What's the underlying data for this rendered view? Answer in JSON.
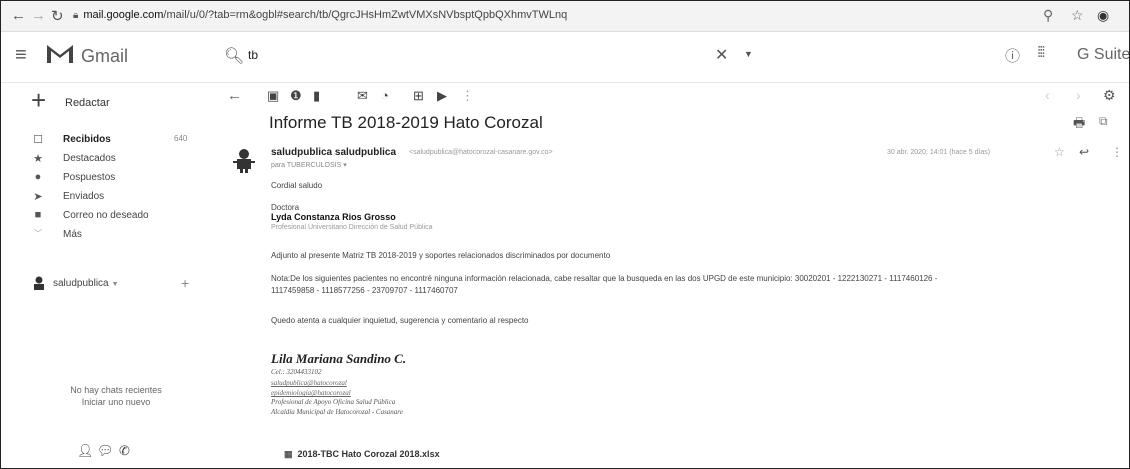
{
  "browser": {
    "back_icon": "arrow-left-icon",
    "forward_icon": "arrow-right-icon",
    "reload_icon": "reload-icon",
    "url_host": "mail.google.com",
    "url_path": "/mail/u/0/?tab=rm&ogbl#search/tb/QgrcJHsHmZwtVMXsNVbsptQpbQXhmvTWLnq"
  },
  "header": {
    "brand": "Gmail",
    "search_value": "tb",
    "apps_brand": "G Suite"
  },
  "sidebar": {
    "compose_label": "Redactar",
    "items": [
      {
        "label": "Recibidos",
        "count": "640",
        "icon": "inbox-icon"
      },
      {
        "label": "Destacados",
        "icon": "star-icon"
      },
      {
        "label": "Pospuestos",
        "icon": "clock-icon"
      },
      {
        "label": "Enviados",
        "icon": "send-icon"
      },
      {
        "label": "Correo no deseado",
        "icon": "label-icon"
      },
      {
        "label": "Más",
        "icon": "chevron-down-icon"
      }
    ],
    "hangouts_user": "saludpublica",
    "no_chats": "No hay chats recientes",
    "start_new": "Iniciar uno nuevo"
  },
  "message": {
    "subject": "Informe TB 2018-2019 Hato Corozal",
    "sender_name": "saludpublica saludpublica",
    "sender_email": "<saludpublica@hatocorozal-casanare.gov.co>",
    "to_line": "para TUBERCULOSIS ▾",
    "date": "30 abr. 2020, 14:01 (hace 5 días)",
    "greeting": "Cordial saludo",
    "doctor_title": "Doctora",
    "doctor_name": "Lyda Constanza Rios Grosso",
    "doctor_role": "Profesional Universitario Dirección de Salud Pública",
    "line_adjunto": "Adjunto al presente Matriz TB 2018-2019 y soportes relacionados discriminados por documento",
    "line_nota_1": "Nota:De los siguientes pacientes no encontré ninguna información relacionada, cabe resaltar que la busqueda en las dos UPGD de este municipio: 30020201 - 1222130271 - 1117460126 -",
    "line_nota_2": "1117459858 - 1118577256 - 23709707 - 1117460707",
    "line_quedo": "Quedo atenta a cualquier inquietud, sugerencia y comentario al respecto",
    "signature": {
      "name": "Lila Mariana Sandino C.",
      "cel": "Cel.: 3204433102",
      "email_1": "saludpublica@hatocorozal",
      "email_2": "epidemiologia@hatocorozal",
      "role_1": "Profesional de Apoyo Oficina Salud Pública",
      "role_2": "Alcaldía Municipal de Hatocorozal - Casanare"
    },
    "attachment_name": "2018-TBC Hato Corozal 2018.xlsx"
  }
}
